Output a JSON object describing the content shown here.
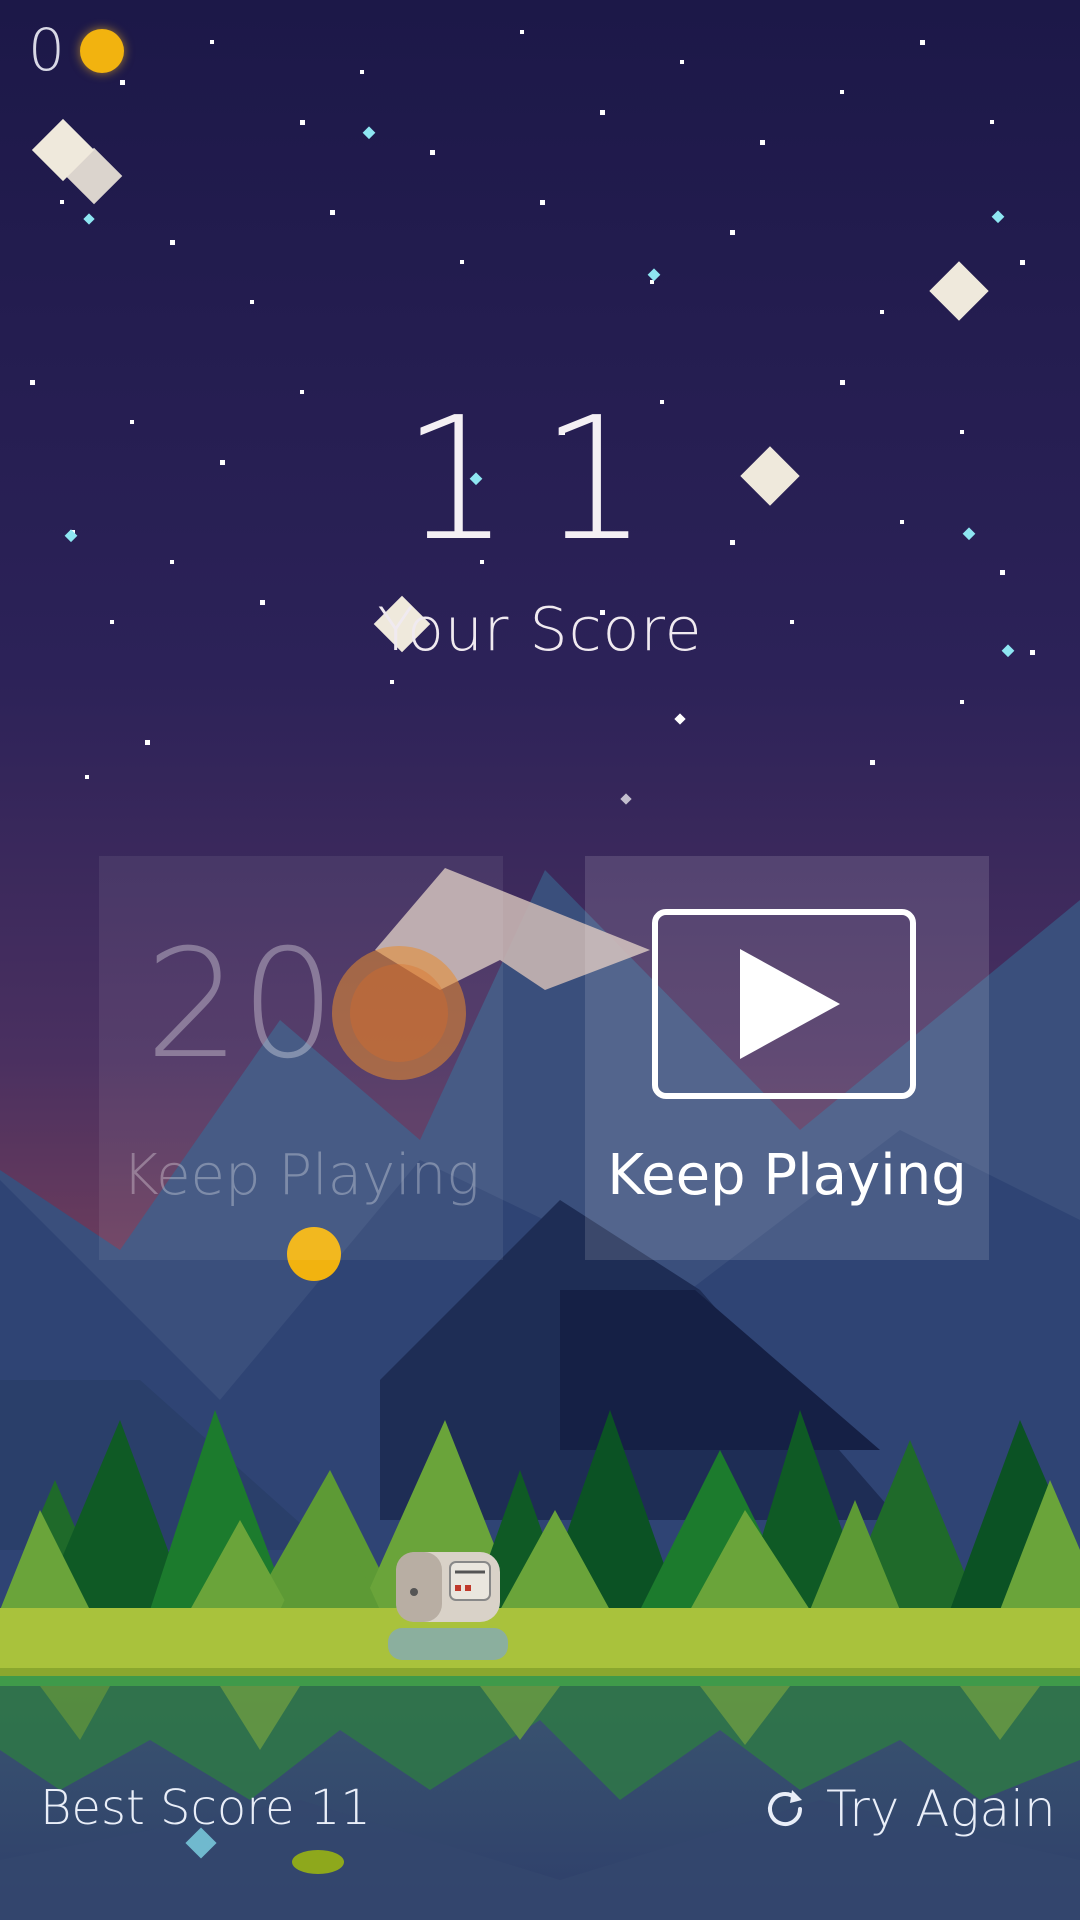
{
  "hud": {
    "coins": "0",
    "coin_icon": "coin-icon"
  },
  "score": {
    "value": "11",
    "label": "Your Score"
  },
  "continue_coins": {
    "cost": "20",
    "label": "Keep Playing"
  },
  "continue_video": {
    "label": "Keep Playing",
    "icon": "play-icon"
  },
  "footer": {
    "best_score": "Best Score 11",
    "try_again": "Try Again",
    "try_again_icon": "refresh-icon"
  },
  "colors": {
    "sky_top": "#1c1848",
    "sky_bottom": "#5a3a60",
    "coin": "#f2b30f",
    "grass": "#a9c23c",
    "panel_text": "#ffffff"
  }
}
